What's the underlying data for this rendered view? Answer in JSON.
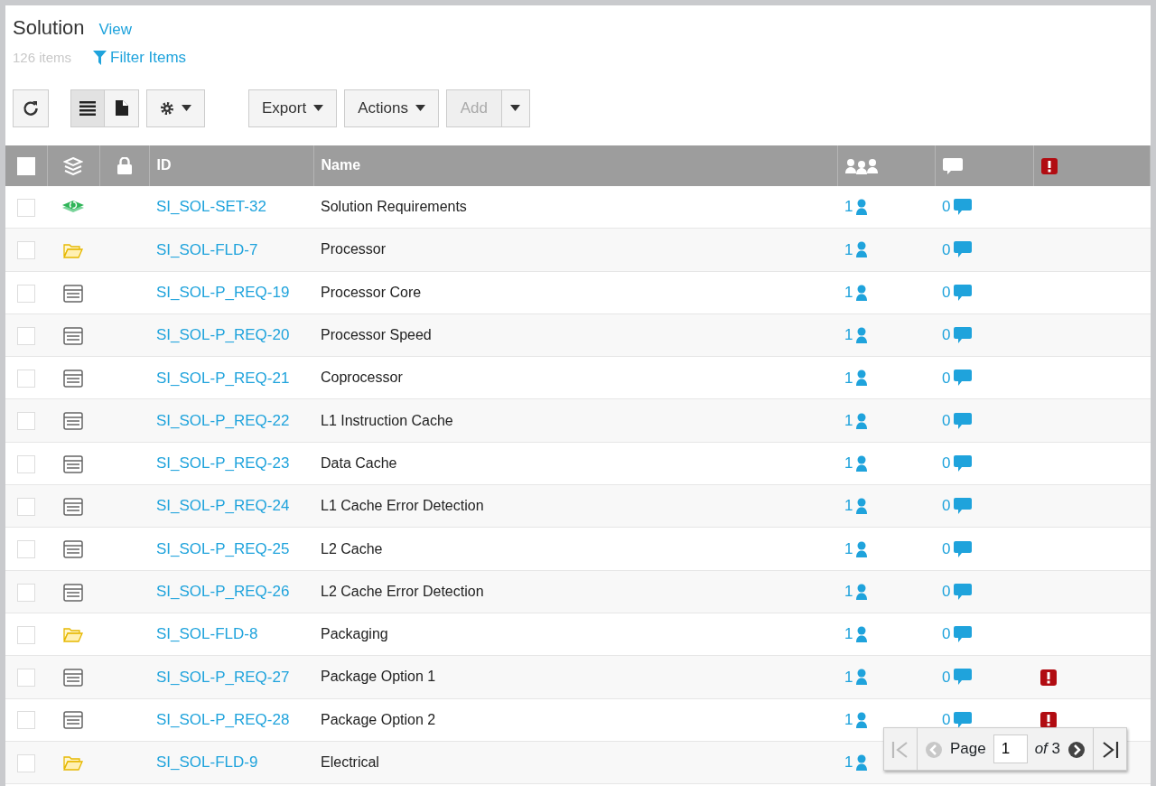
{
  "header": {
    "title": "Solution",
    "view_link": "View",
    "item_count": "126 items",
    "filter_link": "Filter Items"
  },
  "toolbar": {
    "view_modes": [
      {
        "kind": "list",
        "selected": true
      },
      {
        "kind": "document",
        "selected": false
      }
    ],
    "buttons": [
      {
        "label": "Export",
        "disabled": false
      },
      {
        "label": "Actions",
        "disabled": false
      }
    ],
    "add_button": {
      "label": "Add",
      "disabled": true
    }
  },
  "table": {
    "columns": [
      {
        "kind": "select",
        "checked": false
      },
      {
        "kind": "type"
      },
      {
        "kind": "lock"
      },
      {
        "kind": "text",
        "label": "ID"
      },
      {
        "kind": "text",
        "label": "Name"
      },
      {
        "kind": "watchers"
      },
      {
        "kind": "comments"
      },
      {
        "kind": "flag"
      }
    ],
    "rows": [
      {
        "kind": "set",
        "id": "SI_SOL-SET-32",
        "name": "Solution Requirements",
        "watchers": "1",
        "comments": "0",
        "flagged": false,
        "checked": false
      },
      {
        "kind": "folder",
        "id": "SI_SOL-FLD-7",
        "name": "Processor",
        "watchers": "1",
        "comments": "0",
        "flagged": false,
        "checked": false
      },
      {
        "kind": "requirement",
        "id": "SI_SOL-P_REQ-19",
        "name": "Processor Core",
        "watchers": "1",
        "comments": "0",
        "flagged": false,
        "checked": false
      },
      {
        "kind": "requirement",
        "id": "SI_SOL-P_REQ-20",
        "name": "Processor Speed",
        "watchers": "1",
        "comments": "0",
        "flagged": false,
        "checked": false
      },
      {
        "kind": "requirement",
        "id": "SI_SOL-P_REQ-21",
        "name": "Coprocessor",
        "watchers": "1",
        "comments": "0",
        "flagged": false,
        "checked": false
      },
      {
        "kind": "requirement",
        "id": "SI_SOL-P_REQ-22",
        "name": "L1 Instruction Cache",
        "watchers": "1",
        "comments": "0",
        "flagged": false,
        "checked": false
      },
      {
        "kind": "requirement",
        "id": "SI_SOL-P_REQ-23",
        "name": "Data Cache",
        "watchers": "1",
        "comments": "0",
        "flagged": false,
        "checked": false
      },
      {
        "kind": "requirement",
        "id": "SI_SOL-P_REQ-24",
        "name": "L1 Cache Error Detection",
        "watchers": "1",
        "comments": "0",
        "flagged": false,
        "checked": false
      },
      {
        "kind": "requirement",
        "id": "SI_SOL-P_REQ-25",
        "name": "L2 Cache",
        "watchers": "1",
        "comments": "0",
        "flagged": false,
        "checked": false
      },
      {
        "kind": "requirement",
        "id": "SI_SOL-P_REQ-26",
        "name": "L2 Cache Error Detection",
        "watchers": "1",
        "comments": "0",
        "flagged": false,
        "checked": false
      },
      {
        "kind": "folder",
        "id": "SI_SOL-FLD-8",
        "name": "Packaging",
        "watchers": "1",
        "comments": "0",
        "flagged": false,
        "checked": false
      },
      {
        "kind": "requirement",
        "id": "SI_SOL-P_REQ-27",
        "name": "Package Option 1",
        "watchers": "1",
        "comments": "0",
        "flagged": true,
        "checked": false
      },
      {
        "kind": "requirement",
        "id": "SI_SOL-P_REQ-28",
        "name": "Package Option 2",
        "watchers": "1",
        "comments": "0",
        "flagged": true,
        "checked": false
      },
      {
        "kind": "folder",
        "id": "SI_SOL-FLD-9",
        "name": "Electrical",
        "watchers": "1",
        "flagged": false,
        "checked": false
      }
    ]
  },
  "pager": {
    "label": "Page",
    "page": "1",
    "of_label": "of",
    "total": "3"
  }
}
